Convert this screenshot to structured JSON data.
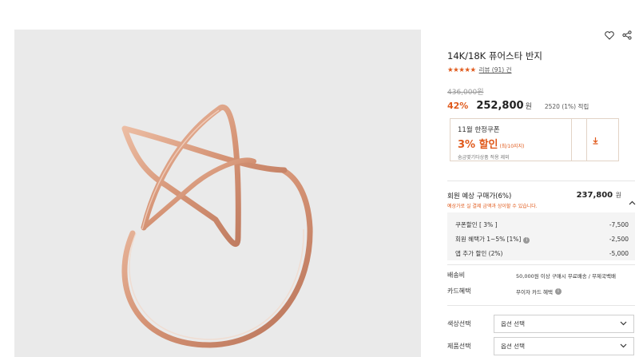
{
  "product": {
    "title": "14K/18K 퓨어스타 반지",
    "stars": "★★★★★",
    "review_label": "리뷰 (91) 건",
    "old_price": "436,000원",
    "discount_rate": "42%",
    "price": "252,800",
    "price_unit": "원",
    "points": "2520 (1%) 적립"
  },
  "coupon": {
    "title": "11월 한정쿠폰",
    "discount": "3% 할인",
    "limit": "(최/10지지)",
    "note": "숨금몇기타상품 적용 제외"
  },
  "member": {
    "label": "회원 예상 구매가(6%)",
    "price": "237,800",
    "unit": "원",
    "note": "예상가로 실 결제 금액과 상이할 수 있습니다."
  },
  "breakdown": [
    {
      "label": "쿠폰할인 [ 3% ]",
      "value": "-7,500"
    },
    {
      "label": "회원 혜택가 1~5% [1%]",
      "value": "-2,500"
    },
    {
      "label": "앱 추가 할인 (2%)",
      "value": "-5,000"
    }
  ],
  "shipping": {
    "label": "배송비",
    "value": "50,000원 이상 구매시 무료배송 / 무제국백배"
  },
  "card": {
    "label": "카드혜택",
    "value": "무이자 카드 혜택"
  },
  "options": [
    {
      "label": "색상선택",
      "placeholder": "옵션 선택"
    },
    {
      "label": "제품선택",
      "placeholder": "옵션 선택"
    }
  ],
  "colors": {
    "accent": "#e05a1c",
    "ring_gold": "#d99a7c",
    "image_bg": "#eaeaea"
  },
  "icons": {
    "wishlist": "heart-icon",
    "share": "share-icon",
    "download": "download-icon",
    "collapse": "chevron-up-icon",
    "dropdown": "chevron-down-icon",
    "info": "info-icon"
  }
}
